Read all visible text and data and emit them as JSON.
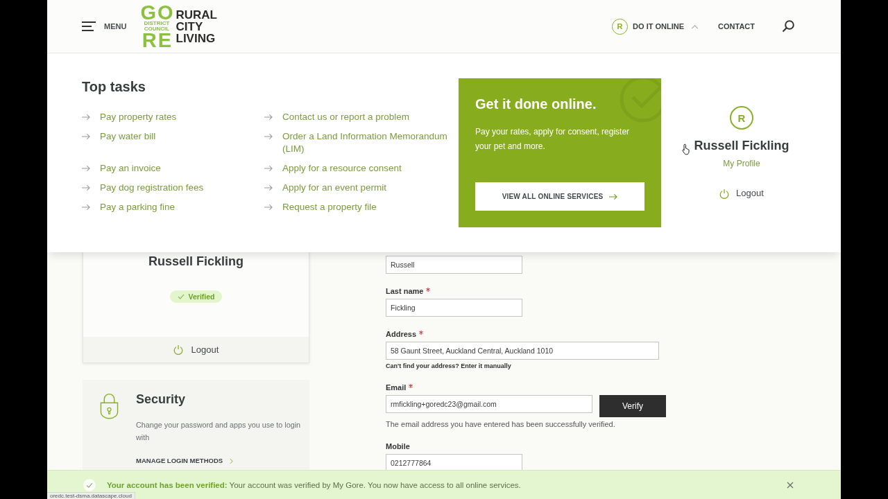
{
  "header": {
    "menu_label": "MENU",
    "logo": {
      "top": "GO",
      "district": "DISTRICT COUNCIL",
      "bottom": "RE",
      "tagline": "RURAL CITY LIVING"
    },
    "nav": [
      {
        "kind": "account",
        "avatar": "R",
        "label": "DO IT ONLINE",
        "expanded": true
      },
      {
        "kind": "link",
        "label": "CONTACT"
      }
    ]
  },
  "top_tasks": {
    "heading": "Top tasks",
    "tasks": [
      "Pay property rates",
      "Contact us or report a problem",
      "Pay water bill",
      "Order a Land Information Memorandum (LIM)",
      "Pay an invoice",
      "Apply for a resource consent",
      "Pay dog registration fees",
      "Apply for an event permit",
      "Pay a parking fine",
      "Request a property file"
    ]
  },
  "promo": {
    "heading": "Get it done online.",
    "text": "Pay your rates, apply for consent, register your pet and more.",
    "button": "VIEW ALL ONLINE SERVICES"
  },
  "account_menu": {
    "avatar": "R",
    "name": "Russell Fickling",
    "profile_link": "My Profile",
    "logout": "Logout"
  },
  "profile_card": {
    "name": "Russell Fickling",
    "badge": "Verified",
    "logout": "Logout"
  },
  "security_card": {
    "heading": "Security",
    "text": "Change your password and apps you use to login with",
    "link": "MANAGE LOGIN METHODS"
  },
  "form": {
    "fields": [
      {
        "kind": "short",
        "required": false,
        "value": "Russell"
      },
      {
        "kind": "short",
        "label": "Last name",
        "required": true,
        "value": "Fickling"
      },
      {
        "kind": "wide",
        "label": "Address",
        "required": true,
        "value": "58 Gaunt Street, Auckland Central, Auckland 1010",
        "help": "Can't find your address? Enter it manually"
      },
      {
        "kind": "action",
        "label": "Email",
        "required": true,
        "value": "rmfickling+goredc23@gmail.com",
        "button": "Verify",
        "note": "The email address you have entered has been successfully verified."
      },
      {
        "kind": "short",
        "label": "Mobile",
        "required": false,
        "value": "0212777864"
      }
    ]
  },
  "notification": {
    "message": "**Your account has been verified:** Your account was verified by My Gore. You now have access to all online services."
  },
  "status_url": "oredc.test-dsma.datascape.cloud"
}
